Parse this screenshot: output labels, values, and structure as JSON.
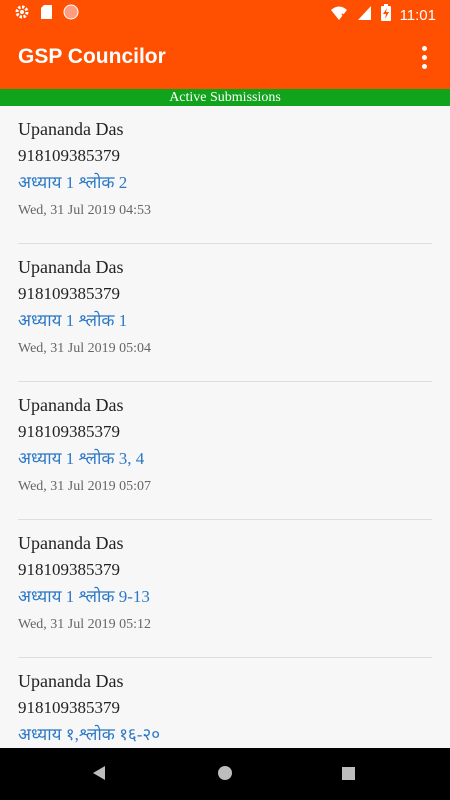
{
  "status_bar": {
    "time": "11:01",
    "icons": [
      "gear-icon",
      "sd-card-icon",
      "circle-notification-icon",
      "wifi-off-icon",
      "signal-icon",
      "battery-charging-icon"
    ],
    "color": "#ff4f00"
  },
  "app_bar": {
    "title": "GSP Councilor",
    "menu_icon": "more-vert-icon",
    "color": "#ff4f00"
  },
  "section": {
    "title": "Active Submissions",
    "color": "#11a31c"
  },
  "submissions": [
    {
      "name": "Upananda Das",
      "phone": "918109385379",
      "verse": "अध्याय 1 श्लोक 2",
      "timestamp": "Wed, 31 Jul 2019 04:53"
    },
    {
      "name": "Upananda Das",
      "phone": "918109385379",
      "verse": "अध्याय 1 श्लोक 1",
      "timestamp": "Wed, 31 Jul 2019 05:04"
    },
    {
      "name": "Upananda Das",
      "phone": "918109385379",
      "verse": "अध्याय 1 श्लोक 3, 4",
      "timestamp": "Wed, 31 Jul 2019 05:07"
    },
    {
      "name": "Upananda Das",
      "phone": "918109385379",
      "verse": "अध्याय 1 श्लोक 9-13",
      "timestamp": "Wed, 31 Jul 2019 05:12"
    },
    {
      "name": "Upananda Das",
      "phone": "918109385379",
      "verse": "अध्याय १,श्लोक १६-२०",
      "timestamp": ""
    }
  ],
  "colors": {
    "verse_link": "#2b78c6",
    "background": "#f7f7f7"
  },
  "nav_bar": {
    "icons": [
      "back-icon",
      "home-icon",
      "recents-icon"
    ]
  }
}
